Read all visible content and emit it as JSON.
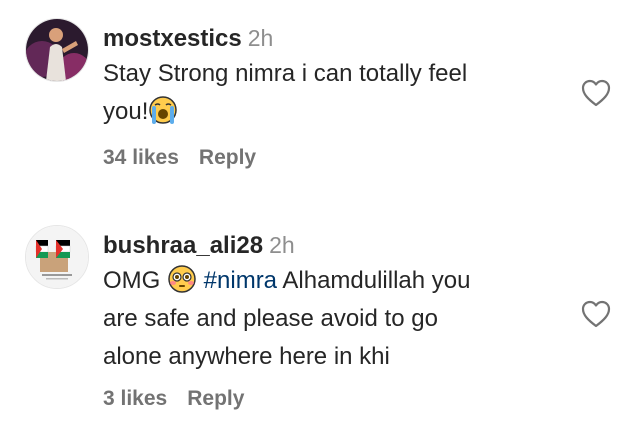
{
  "comments": [
    {
      "username": "mostxestics",
      "time": "2h",
      "text_line1": "Stay Strong nimra i can totally feel",
      "text_line2": "you!",
      "emoji": "crying-face-icon",
      "likes": "34 likes",
      "reply": "Reply"
    },
    {
      "username": "bushraa_ali28",
      "time": "2h",
      "text_start": "OMG",
      "emoji": "flushed-face-icon",
      "hashtag": "#nimra",
      "text_rest1": " Alhamdulillah you",
      "text_line2": "are safe and please avoid to go",
      "text_line3": "alone anywhere here in khi",
      "likes": "3 likes",
      "reply": "Reply"
    }
  ],
  "colors": {
    "text": "#262626",
    "muted": "#8e8e8e",
    "hashtag": "#00376b"
  }
}
